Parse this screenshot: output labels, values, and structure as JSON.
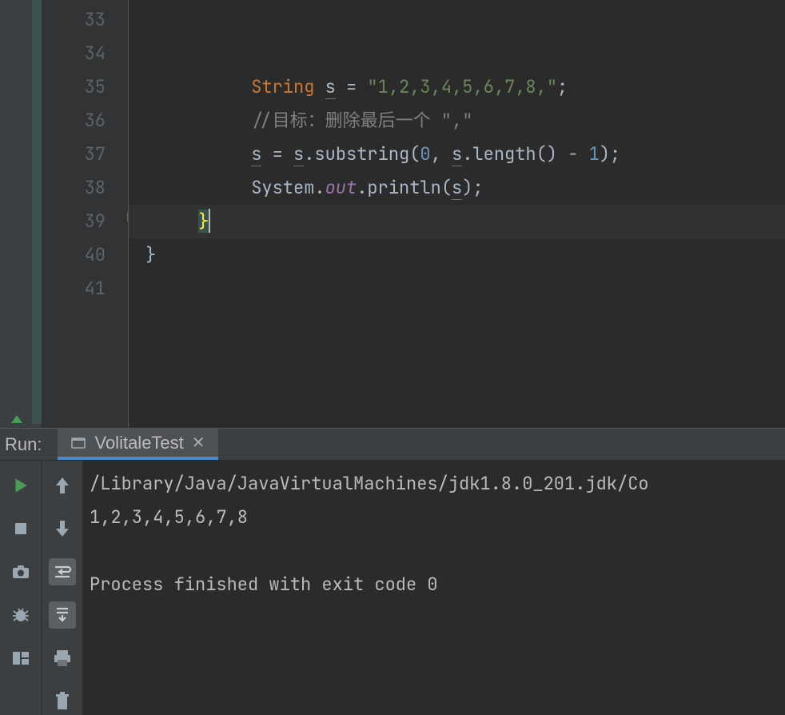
{
  "editor": {
    "lines": [
      "33",
      "34",
      "35",
      "36",
      "37",
      "38",
      "39",
      "40",
      "41"
    ],
    "code": {
      "l35_kw": "String",
      "l35_var1": "s",
      "l35_eq": " = ",
      "l35_str": "\"1,2,3,4,5,6,7,8,\"",
      "l35_end": ";",
      "l36_cmt": "//目标：删除最后一个 \",\"",
      "l37_v1": "s",
      "l37_a": " = ",
      "l37_v2": "s",
      "l37_b": ".substring(",
      "l37_n0": "0",
      "l37_c": ", ",
      "l37_v3": "s",
      "l37_d": ".length() - ",
      "l37_n1": "1",
      "l37_e": ");",
      "l38_a": "System.",
      "l38_out": "out",
      "l38_b": ".println(",
      "l38_v": "s",
      "l38_c": ");",
      "l39_brace": "}",
      "l40_brace": "}"
    }
  },
  "run": {
    "label": "Run:",
    "tab": "VolitaleTest",
    "console": {
      "path": "/Library/Java/JavaVirtualMachines/jdk1.8.0_201.jdk/Co",
      "out1": "1,2,3,4,5,6,7,8",
      "blank": "",
      "out2": "Process finished with exit code 0"
    }
  },
  "icons": {
    "run": "run-icon",
    "stop": "stop-icon",
    "camera": "camera-icon",
    "bug": "bug-icon",
    "layout": "layout-icon",
    "up": "up-arrow-icon",
    "down": "down-arrow-icon",
    "wrap": "soft-wrap-icon",
    "scroll": "scroll-to-end-icon",
    "print": "print-icon",
    "trash": "trash-icon",
    "tab": "app-icon",
    "fold": "fold-end-icon"
  }
}
